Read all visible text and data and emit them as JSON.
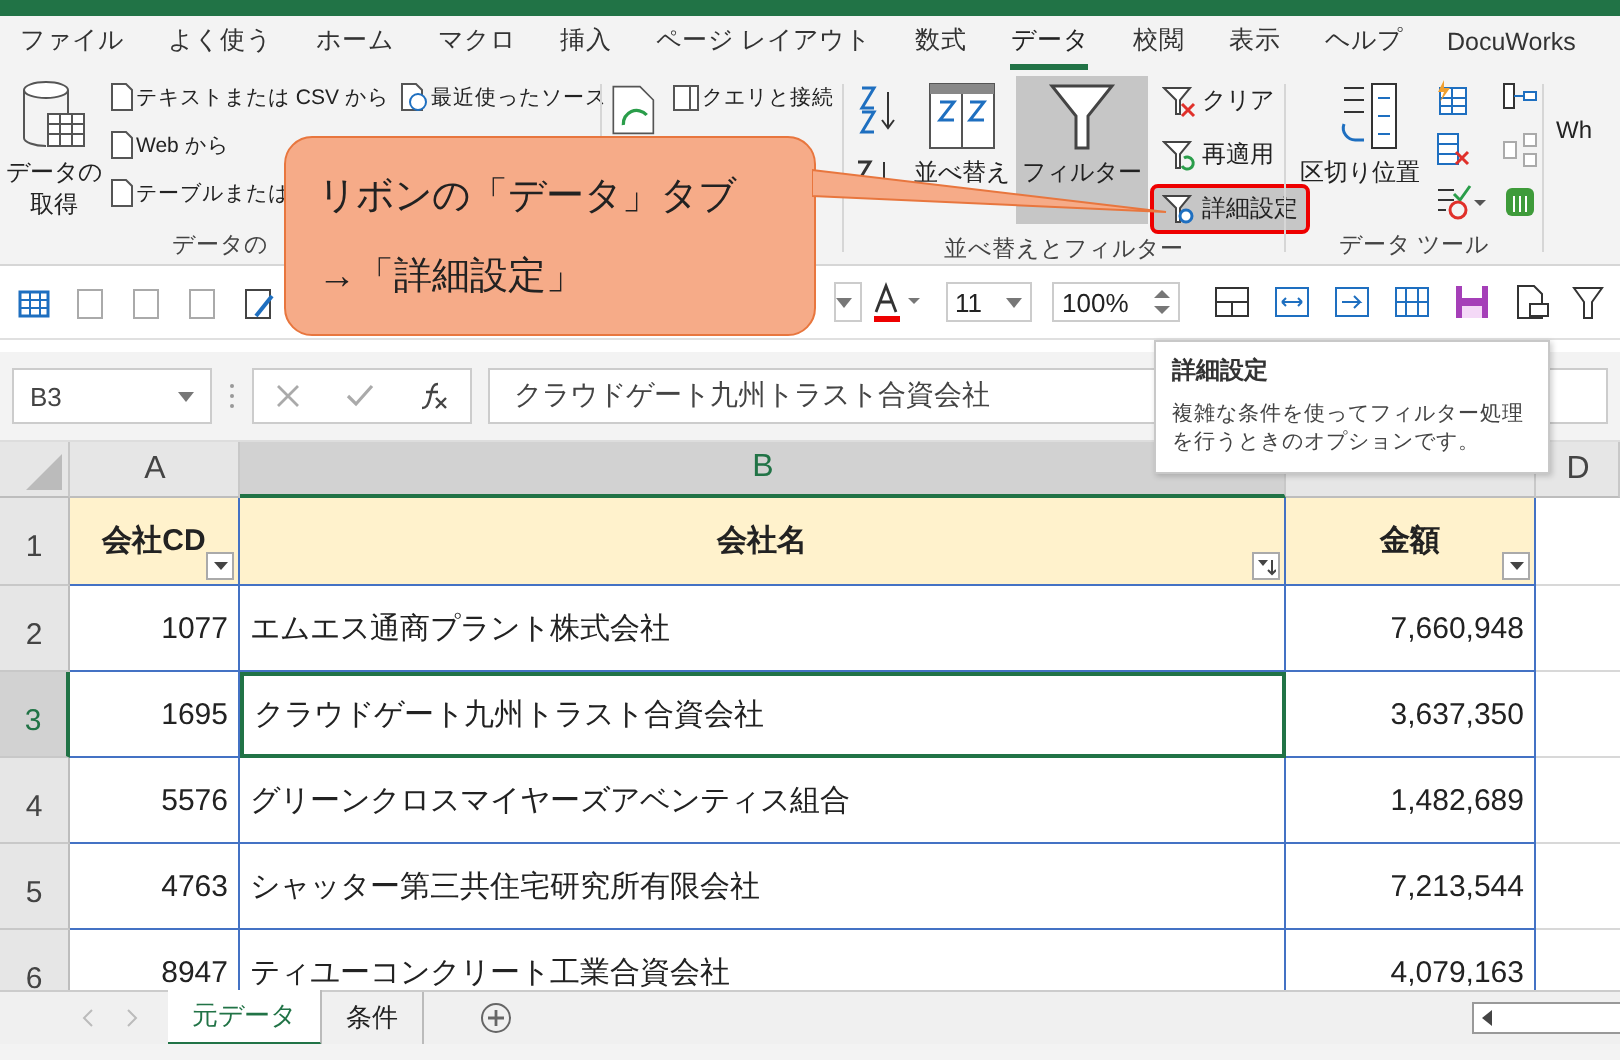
{
  "ribbon_tabs": [
    {
      "label": "ファイル",
      "selected": false
    },
    {
      "label": "よく使う",
      "selected": false
    },
    {
      "label": "ホーム",
      "selected": false
    },
    {
      "label": "マクロ",
      "selected": false
    },
    {
      "label": "挿入",
      "selected": false
    },
    {
      "label": "ページ レイアウト",
      "selected": false
    },
    {
      "label": "数式",
      "selected": false
    },
    {
      "label": "データ",
      "selected": true
    },
    {
      "label": "校閲",
      "selected": false
    },
    {
      "label": "表示",
      "selected": false
    },
    {
      "label": "ヘルプ",
      "selected": false
    },
    {
      "label": "DocuWorks",
      "selected": false
    }
  ],
  "ribbon": {
    "get_data": {
      "big_button": [
        "データの",
        "取得"
      ],
      "items": [
        "テキストまたは CSV から",
        "Web から",
        "テーブルまたは"
      ],
      "recent": "最近使ったソース",
      "group_label": "データの"
    },
    "queries": {
      "items": [
        "クエリと接続"
      ]
    },
    "sort_filter": {
      "sort": "並べ替え",
      "filter": {
        "label": "フィルター",
        "on": true
      },
      "items": [
        {
          "label": "クリア",
          "kind": "clear",
          "highlighted": false
        },
        {
          "label": "再適用",
          "kind": "reapply",
          "highlighted": false
        },
        {
          "label": "詳細設定",
          "kind": "advanced",
          "highlighted": true
        }
      ],
      "group_label": "並べ替えとフィルター"
    },
    "data_tools": {
      "split": "区切り位置",
      "group_label": "データ ツール"
    },
    "cut_label": "Wh"
  },
  "toolbar": {
    "font_size": "11",
    "zoom": "100%"
  },
  "name_box": "B3",
  "formula": "クラウドゲート九州トラスト合資会社",
  "column_headers": [
    {
      "label": "A",
      "selected": false
    },
    {
      "label": "B",
      "selected": true
    },
    {
      "selected": false
    },
    {
      "label": "D",
      "selected": false
    }
  ],
  "header_row": {
    "row": "1",
    "cells": [
      {
        "text": "会社CD",
        "kind": "filter"
      },
      {
        "text": "会社名",
        "kind": "sorted"
      },
      {
        "text": "金額",
        "kind": "filter"
      }
    ]
  },
  "rows": [
    {
      "row": "2",
      "selected": false,
      "cells": [
        "1077",
        "エムエス通商プラント株式会社",
        "7,660,948"
      ]
    },
    {
      "row": "3",
      "selected": true,
      "cells": [
        "1695",
        "クラウドゲート九州トラスト合資会社",
        "3,637,350"
      ]
    },
    {
      "row": "4",
      "selected": false,
      "cells": [
        "5576",
        "グリーンクロスマイヤーズアベンティス組合",
        "1,482,689"
      ]
    },
    {
      "row": "5",
      "selected": false,
      "cells": [
        "4763",
        "シャッター第三共住宅研究所有限会社",
        "7,213,544"
      ]
    },
    {
      "row": "6",
      "selected": false,
      "cells": [
        "8947",
        "ティユーコンクリート工業合資会社",
        "4,079,163"
      ]
    }
  ],
  "sheet_tabs": [
    {
      "label": "元データ",
      "selected": true
    },
    {
      "label": "条件",
      "selected": false
    }
  ],
  "tooltip": {
    "title": "詳細設定",
    "body": "複雑な条件を使ってフィルター処理を行うときのオプションです。"
  },
  "callout": {
    "lines": [
      "リボンの「データ」タブ",
      "→「詳細設定」"
    ]
  }
}
